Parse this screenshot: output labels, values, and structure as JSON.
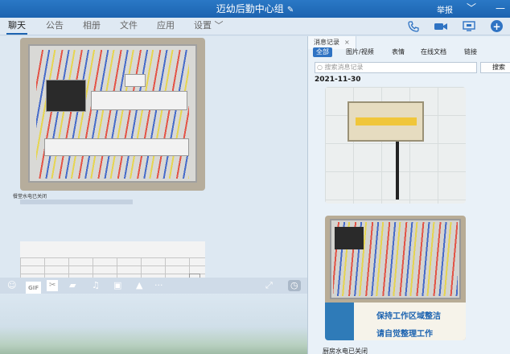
{
  "window": {
    "title": "迈幼后勤中心组",
    "report_label": "举报",
    "controls": [
      "﹀",
      "—"
    ]
  },
  "tabs": [
    {
      "label": "聊天",
      "active": true
    },
    {
      "label": "公告"
    },
    {
      "label": "相册"
    },
    {
      "label": "文件"
    },
    {
      "label": "应用"
    },
    {
      "label": "设置 ﹀"
    }
  ],
  "actions": {
    "voice": "phone-icon",
    "video": "video-icon",
    "screen": "screen-share-icon",
    "add": "+"
  },
  "chat": {
    "caption_1": "餐堂水电已关闭"
  },
  "toolbar": {
    "gif_label": "GIF",
    "more_label": "···"
  },
  "history": {
    "tab_label": "消息记录",
    "close_glyph": "×",
    "filters": [
      "全部",
      "图片/视频",
      "表情",
      "在线文档",
      "链接"
    ],
    "search_placeholder": "搜索消息记录",
    "search_button": "搜索",
    "date": "2021-11-30",
    "caption_last": "厨房水电已关闭"
  },
  "sign": {
    "line1": "保持工作区域整洁",
    "line2": "请自觉整理工作"
  },
  "colors": {
    "accent": "#2f73c3",
    "title_bg": "#1c63b0",
    "panel_bg": "#dde8f2"
  }
}
